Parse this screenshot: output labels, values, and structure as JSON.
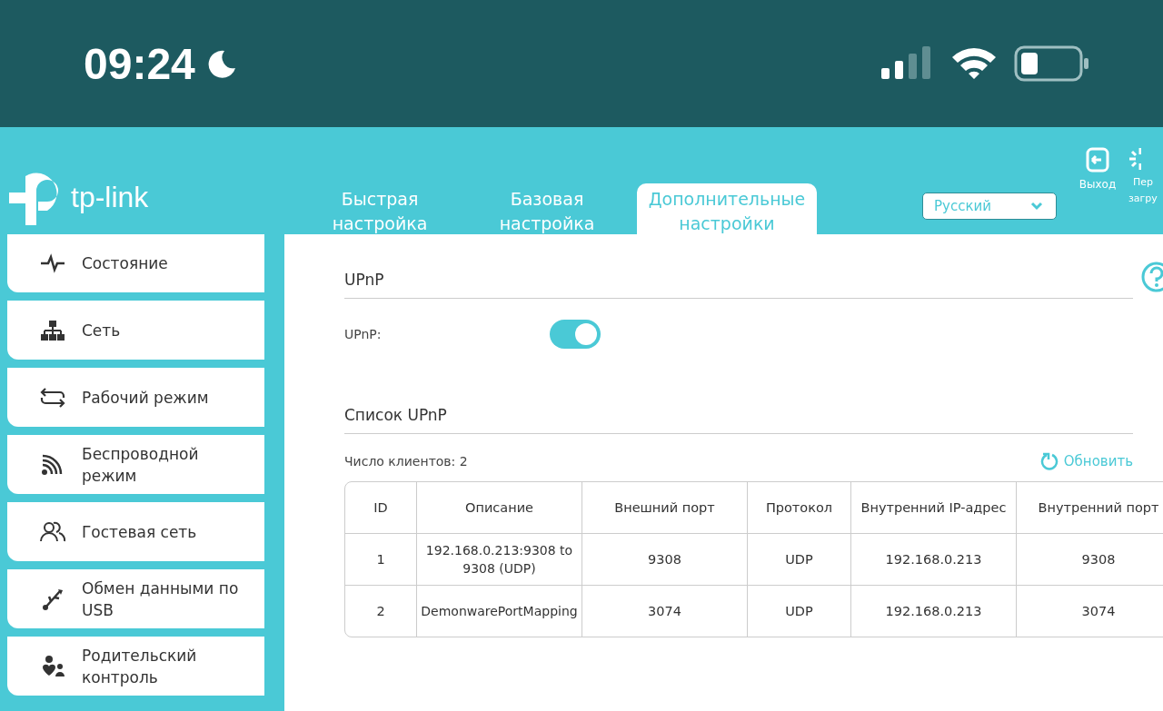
{
  "phone_status": {
    "time": "09:24"
  },
  "header": {
    "logo": "tp-link",
    "tabs": [
      {
        "label": "Быстрая настройка",
        "selected": false
      },
      {
        "label": "Базовая настройка",
        "selected": false
      },
      {
        "label": "Дополнительные настройки",
        "selected": true
      }
    ],
    "language": {
      "value": "Русский"
    },
    "actions": [
      {
        "kind": "logout",
        "label": "Выход"
      },
      {
        "kind": "reboot",
        "label": "Пер\nзагру"
      }
    ]
  },
  "sidebar": {
    "items": [
      {
        "kind": "status",
        "label": "Состояние"
      },
      {
        "kind": "network",
        "label": "Сеть"
      },
      {
        "kind": "mode",
        "label": "Рабочий режим"
      },
      {
        "kind": "wireless",
        "label": "Беспроводной режим"
      },
      {
        "kind": "guest",
        "label": "Гостевая сеть"
      },
      {
        "kind": "usb",
        "label": "Обмен данными по USB"
      },
      {
        "kind": "parental",
        "label": "Родительский контроль"
      }
    ]
  },
  "upnp": {
    "title": "UPnP",
    "toggle_label": "UPnP:",
    "on": true
  },
  "upnp_list": {
    "title": "Список UPnP",
    "client_count": "Число клиентов: 2",
    "refresh": "Обновить",
    "columns": [
      "ID",
      "Описание",
      "Внешний порт",
      "Протокол",
      "Внутренний IP-адрес",
      "Внутренний порт"
    ],
    "rows": [
      [
        "1",
        "192.168.0.213:9308 to 9308 (UDP)",
        "9308",
        "UDP",
        "192.168.0.213",
        "9308"
      ],
      [
        "2",
        "DemonwarePortMapping",
        "3074",
        "UDP",
        "192.168.0.213",
        "3074"
      ]
    ]
  }
}
